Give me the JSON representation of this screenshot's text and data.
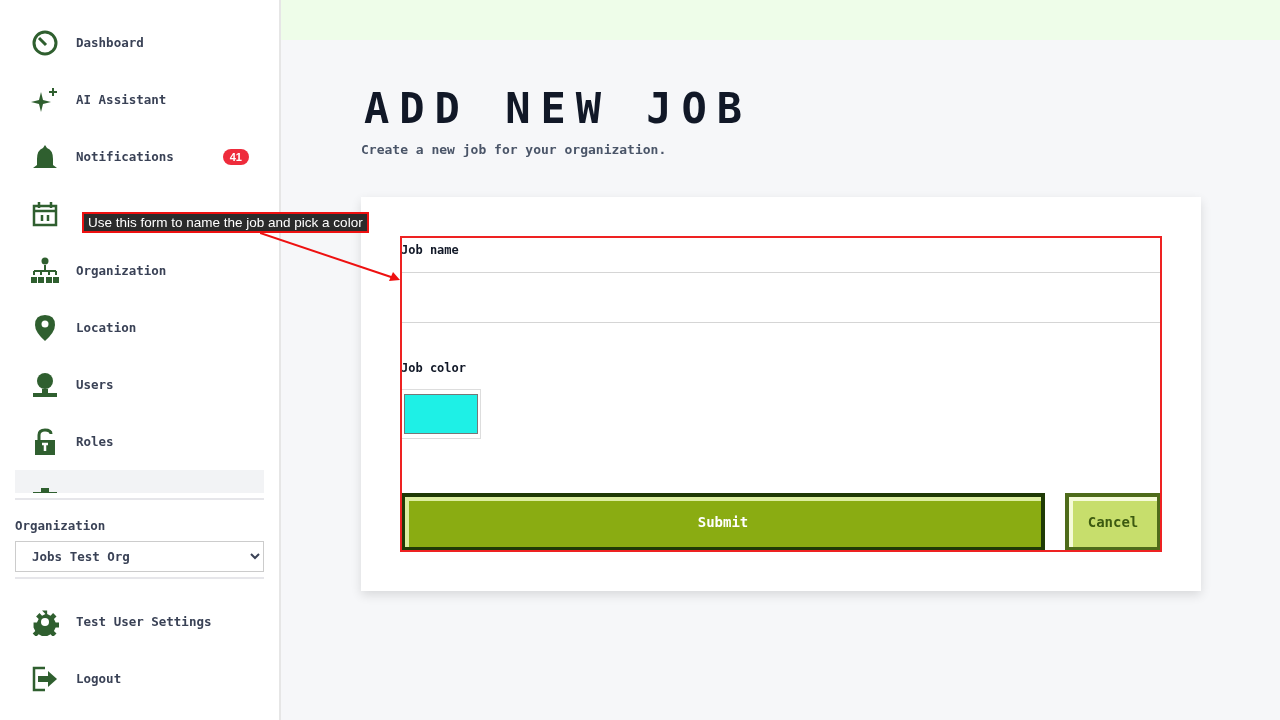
{
  "sidebar": {
    "nav_items": [
      {
        "label": "Dashboard",
        "selected": false
      },
      {
        "label": "AI Assistant",
        "selected": false
      },
      {
        "label": "Notifications",
        "badge": "41",
        "selected": false
      },
      {
        "selected": false
      },
      {
        "label": "Organization",
        "selected": false
      },
      {
        "label": "Location",
        "selected": false
      },
      {
        "label": "Users",
        "selected": false
      },
      {
        "label": "Roles",
        "selected": false
      },
      {
        "selected": true
      }
    ],
    "organization": {
      "label": "Organization",
      "value": "Jobs Test Org"
    },
    "footer_items": [
      {
        "label": "Test User Settings"
      },
      {
        "label": "Logout"
      }
    ]
  },
  "page": {
    "title": "ADD NEW JOB",
    "subtitle": "Create a new job for your organization."
  },
  "form": {
    "job_name": {
      "label": "Job name"
    },
    "job_color": {
      "label": "Job color"
    },
    "buttons": [
      {
        "kind": "primary",
        "label": "Submit"
      },
      {
        "kind": "secondary",
        "label": "Cancel"
      }
    ]
  },
  "annotation": {
    "text": "Use this form to name the job and pick a color"
  }
}
